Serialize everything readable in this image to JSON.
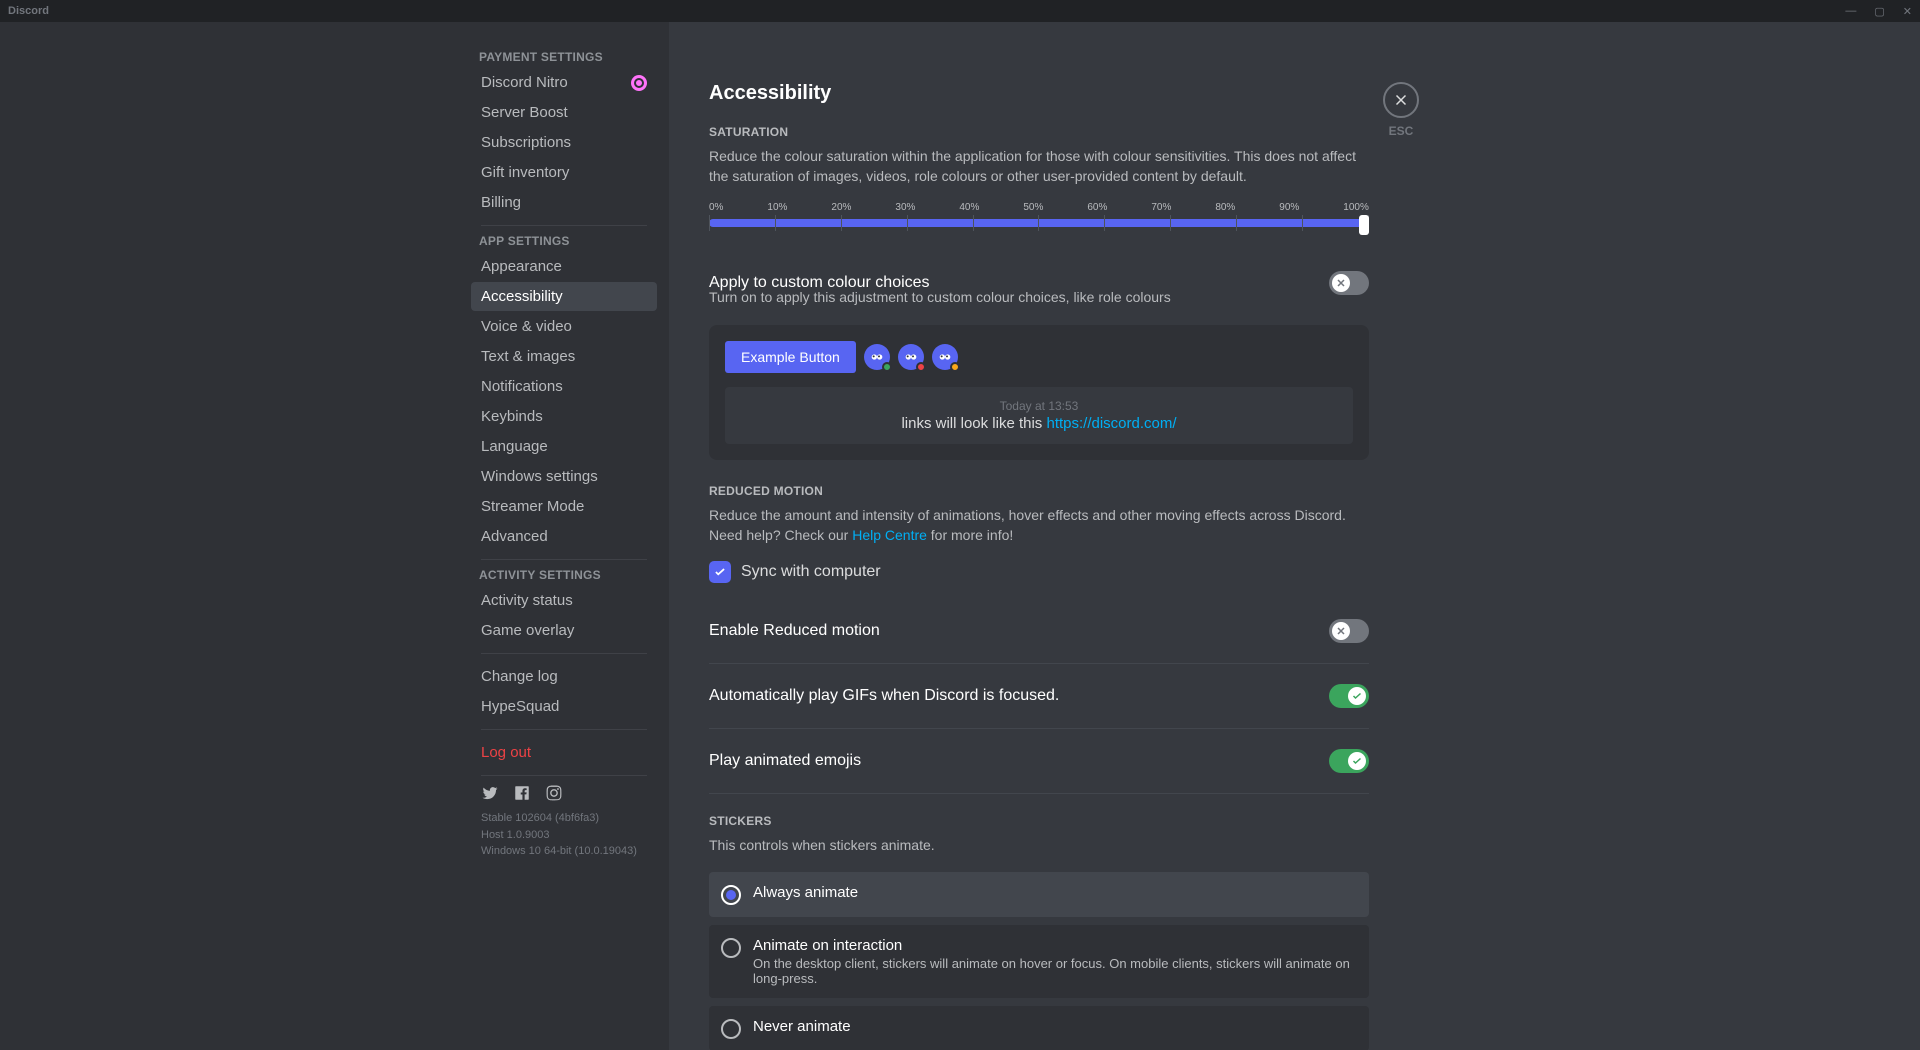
{
  "titlebar": {
    "app": "Discord"
  },
  "sidebar": {
    "categories": [
      {
        "label": "PAYMENT SETTINGS",
        "items": [
          {
            "label": "Discord Nitro",
            "nitro": true
          },
          {
            "label": "Server Boost"
          },
          {
            "label": "Subscriptions"
          },
          {
            "label": "Gift inventory"
          },
          {
            "label": "Billing"
          }
        ]
      },
      {
        "label": "APP SETTINGS",
        "items": [
          {
            "label": "Appearance"
          },
          {
            "label": "Accessibility",
            "active": true
          },
          {
            "label": "Voice & video"
          },
          {
            "label": "Text & images"
          },
          {
            "label": "Notifications"
          },
          {
            "label": "Keybinds"
          },
          {
            "label": "Language"
          },
          {
            "label": "Windows settings"
          },
          {
            "label": "Streamer Mode"
          },
          {
            "label": "Advanced"
          }
        ]
      },
      {
        "label": "ACTIVITY SETTINGS",
        "items": [
          {
            "label": "Activity status"
          },
          {
            "label": "Game overlay"
          }
        ]
      }
    ],
    "extra": [
      {
        "label": "Change log"
      },
      {
        "label": "HypeSquad"
      }
    ],
    "logout": "Log out",
    "footer": {
      "line1": "Stable 102604 (4bf6fa3)",
      "line2": "Host 1.0.9003",
      "line3": "Windows 10 64-bit (10.0.19043)"
    }
  },
  "content": {
    "title": "Accessibility",
    "close_label": "ESC",
    "saturation": {
      "header": "SATURATION",
      "desc": "Reduce the colour saturation within the application for those with colour sensitivities. This does not affect the saturation of images, videos, role colours or other user-provided content by default.",
      "ticks": [
        "0%",
        "10%",
        "20%",
        "30%",
        "40%",
        "50%",
        "60%",
        "70%",
        "80%",
        "90%",
        "100%"
      ],
      "value": 100
    },
    "custom_colour": {
      "title": "Apply to custom colour choices",
      "note": "Turn on to apply this adjustment to custom colour choices, like role colours",
      "on": false
    },
    "preview": {
      "button": "Example Button",
      "timestamp": "Today at 13:53",
      "text": "links will look like this ",
      "link": "https://discord.com/"
    },
    "reduced_motion": {
      "header": "REDUCED MOTION",
      "desc_pre": "Reduce the amount and intensity of animations, hover effects and other moving effects across Discord. Need help? Check our ",
      "help": "Help Centre",
      "desc_post": " for more info!",
      "sync": "Sync with computer",
      "enable_title": "Enable Reduced motion",
      "enable_on": false
    },
    "gifs": {
      "title": "Automatically play GIFs when Discord is focused.",
      "on": true
    },
    "emojis": {
      "title": "Play animated emojis",
      "on": true
    },
    "stickers": {
      "header": "STICKERS",
      "desc": "This controls when stickers animate.",
      "options": [
        {
          "label": "Always animate",
          "selected": true
        },
        {
          "label": "Animate on interaction",
          "desc": "On the desktop client, stickers will animate on hover or focus. On mobile clients, stickers will animate on long-press.",
          "selected": false
        },
        {
          "label": "Never animate",
          "selected": false
        }
      ]
    }
  }
}
